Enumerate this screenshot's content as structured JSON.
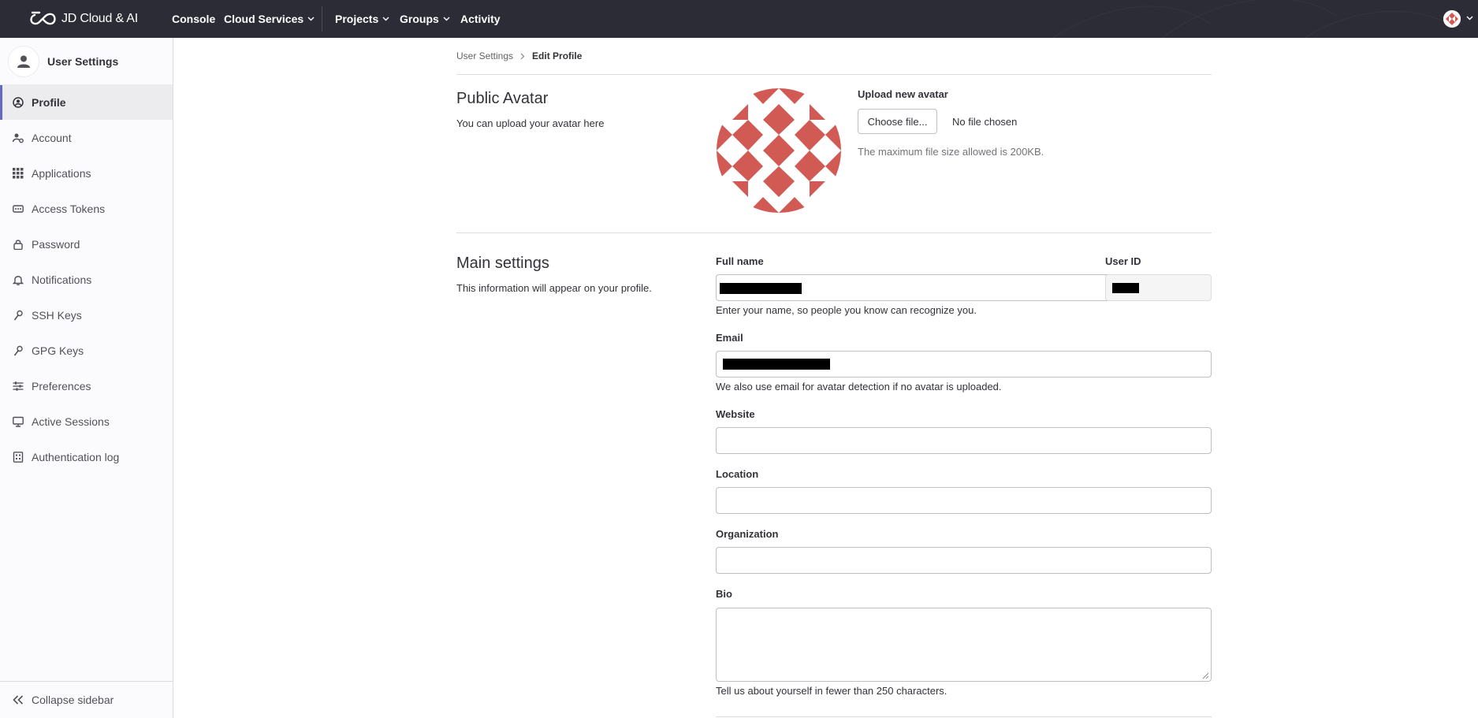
{
  "topbar": {
    "brand": "JD Cloud & AI",
    "nav": [
      {
        "label": "Console",
        "dropdown": false
      },
      {
        "label": "Cloud Services",
        "dropdown": true
      },
      {
        "label": "Projects",
        "dropdown": true
      },
      {
        "label": "Groups",
        "dropdown": true
      },
      {
        "label": "Activity",
        "dropdown": false
      }
    ],
    "colors": {
      "background": "#2b2c36"
    }
  },
  "sidebar": {
    "title": "User Settings",
    "items": [
      {
        "label": "Profile",
        "icon": "profile-icon",
        "active": true
      },
      {
        "label": "Account",
        "icon": "account-icon",
        "active": false
      },
      {
        "label": "Applications",
        "icon": "applications-icon",
        "active": false
      },
      {
        "label": "Access Tokens",
        "icon": "token-icon",
        "active": false
      },
      {
        "label": "Password",
        "icon": "lock-icon",
        "active": false
      },
      {
        "label": "Notifications",
        "icon": "bell-icon",
        "active": false
      },
      {
        "label": "SSH Keys",
        "icon": "key-icon",
        "active": false
      },
      {
        "label": "GPG Keys",
        "icon": "key-icon",
        "active": false
      },
      {
        "label": "Preferences",
        "icon": "sliders-icon",
        "active": false
      },
      {
        "label": "Active Sessions",
        "icon": "monitor-icon",
        "active": false
      },
      {
        "label": "Authentication log",
        "icon": "log-icon",
        "active": false
      }
    ],
    "collapse_label": "Collapse sidebar",
    "colors": {
      "active_indicator": "#6666c4"
    }
  },
  "breadcrumb": {
    "parent": "User Settings",
    "current": "Edit Profile"
  },
  "avatar_section": {
    "title": "Public Avatar",
    "description": "You can upload your avatar here",
    "upload_label": "Upload new avatar",
    "choose_button": "Choose file...",
    "file_status": "No file chosen",
    "max_size_note": "The maximum file size allowed is 200KB.",
    "avatar_color": "#d15a55"
  },
  "main_settings": {
    "title": "Main settings",
    "description": "This information will appear on your profile.",
    "full_name": {
      "label": "Full name",
      "help": "Enter your name, so people you know can recognize you."
    },
    "user_id": {
      "label": "User ID"
    },
    "email": {
      "label": "Email",
      "help": "We also use email for avatar detection if no avatar is uploaded."
    },
    "website": {
      "label": "Website",
      "value": ""
    },
    "location": {
      "label": "Location",
      "value": ""
    },
    "organization": {
      "label": "Organization",
      "value": ""
    },
    "bio": {
      "label": "Bio",
      "value": "",
      "help": "Tell us about yourself in fewer than 250 characters."
    }
  }
}
